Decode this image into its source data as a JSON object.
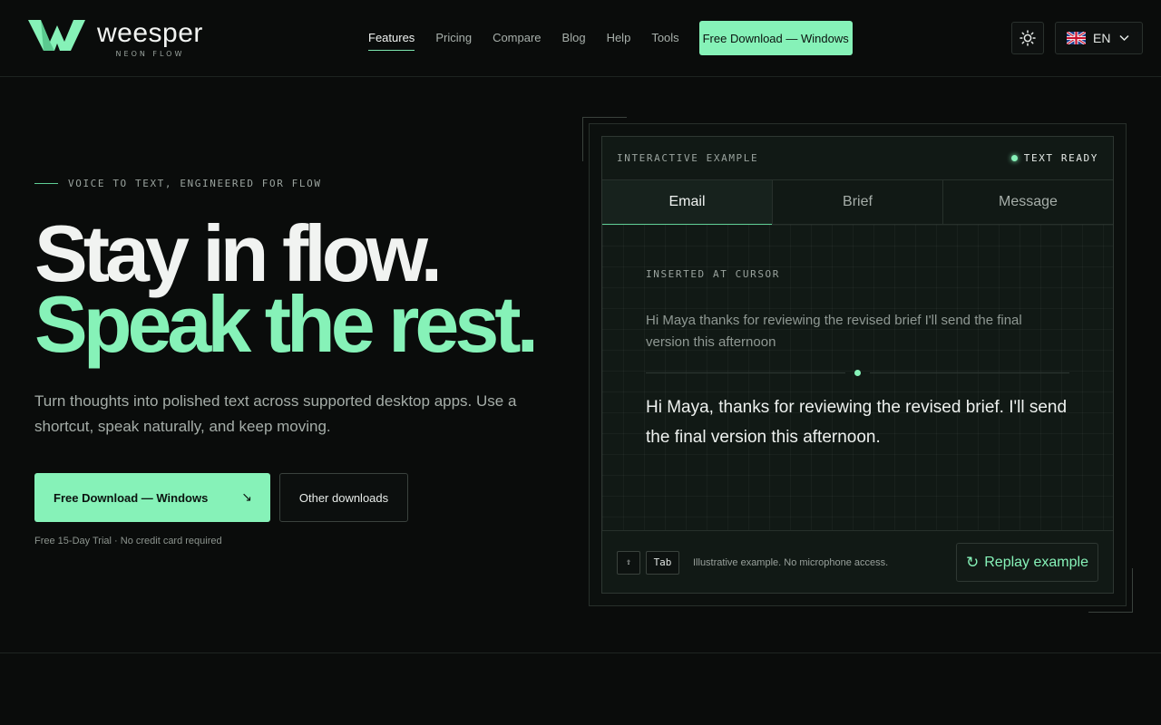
{
  "brand": {
    "name": "weesper",
    "tagline": "NEON FLOW"
  },
  "nav": {
    "items": [
      {
        "label": "Features",
        "active": true
      },
      {
        "label": "Pricing"
      },
      {
        "label": "Compare"
      },
      {
        "label": "Blog"
      },
      {
        "label": "Help"
      },
      {
        "label": "Tools"
      }
    ],
    "cta": "Free Download — Windows"
  },
  "header_controls": {
    "theme_icon": "sun-icon",
    "language": "EN",
    "flag_icon": "uk-flag-icon"
  },
  "hero": {
    "eyebrow": "VOICE TO TEXT, ENGINEERED FOR FLOW",
    "headline_1": "Stay in flow.",
    "headline_2": "Speak the rest.",
    "lede": "Turn thoughts into polished text across supported desktop apps. Use a shortcut, speak naturally, and keep moving.",
    "primary_cta": "Free Download — Windows",
    "primary_cta_arrow": "↘",
    "secondary_cta": "Other downloads",
    "trial_note": "Free 15-Day Trial · No credit card required"
  },
  "demo": {
    "title": "INTERACTIVE EXAMPLE",
    "status": "TEXT READY",
    "tabs": [
      {
        "label": "Email",
        "active": true
      },
      {
        "label": "Brief"
      },
      {
        "label": "Message"
      }
    ],
    "inserted_label": "INSERTED AT CURSOR",
    "raw_text": "Hi Maya thanks for reviewing the revised brief I'll send the final version this afternoon",
    "polished_text": "Hi Maya, thanks for reviewing the revised brief. I'll send the final version this afternoon.",
    "keys": [
      "⇧",
      "Tab"
    ],
    "footnote": "Illustrative example. No microphone access.",
    "replay_label": "Replay example",
    "replay_icon": "↻"
  },
  "colors": {
    "accent": "#86f2b8",
    "background": "#0a0c0b"
  }
}
